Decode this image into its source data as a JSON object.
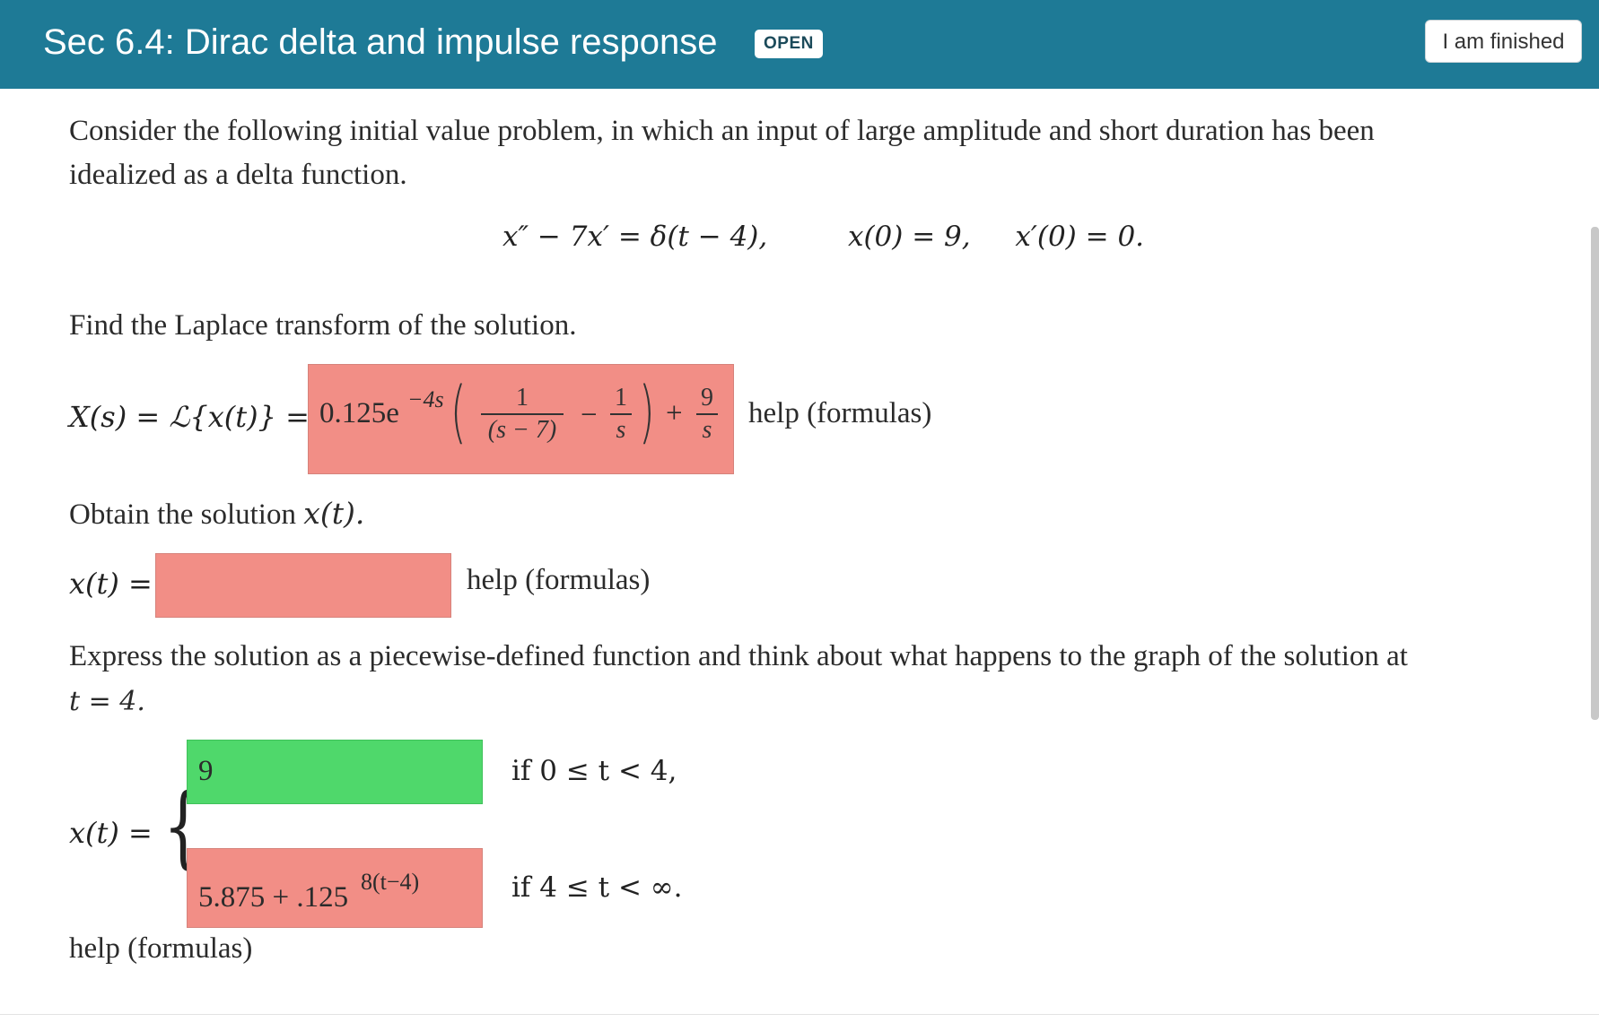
{
  "header": {
    "title": "Sec 6.4: Dirac delta and impulse response",
    "status_badge": "OPEN",
    "finish_button": "I am finished",
    "bg_color": "#1e7a96"
  },
  "problem": {
    "intro_line1": "Consider the following initial value problem, in which an input of large amplitude and short duration has been",
    "intro_line2": "idealized as a delta function.",
    "equation": "x″ − 7x′ = δ(t − 4),",
    "initial_x": "x(0) = 9,",
    "initial_dx": "x′(0) = 0.",
    "part1_prompt": "Find the Laplace transform of the solution.",
    "part1_label": "X(s) = ℒ{x(t)} =",
    "part1_answer": {
      "coef": "0.125e",
      "exp": "−4s",
      "frac1_num": "1",
      "frac1_den": "(s − 7)",
      "minus": "−",
      "frac2_num": "1",
      "frac2_den": "s",
      "plus": "+",
      "frac3_num": "9",
      "frac3_den": "s",
      "status": "incorrect"
    },
    "part2_prompt_text": "Obtain the solution ",
    "part2_prompt_var": "x(t).",
    "part2_label": "x(t) =",
    "part2_answer": "",
    "part3_prompt_line1": "Express the solution as a piecewise-defined function and think about what happens to the graph of the solution at",
    "part3_prompt_line2": "t = 4.",
    "part3_label": "x(t) =",
    "piece1_value": "9",
    "piece1_cond": "if  0 ≤ t < 4,",
    "piece2_value_base": "5.875 + .125",
    "piece2_value_exp": "8(t−4)",
    "piece2_cond": "if  4 ≤ t < ∞.",
    "help_label": "help (formulas)"
  },
  "colors": {
    "incorrect": "#f28e86",
    "correct": "#4fd86b"
  }
}
